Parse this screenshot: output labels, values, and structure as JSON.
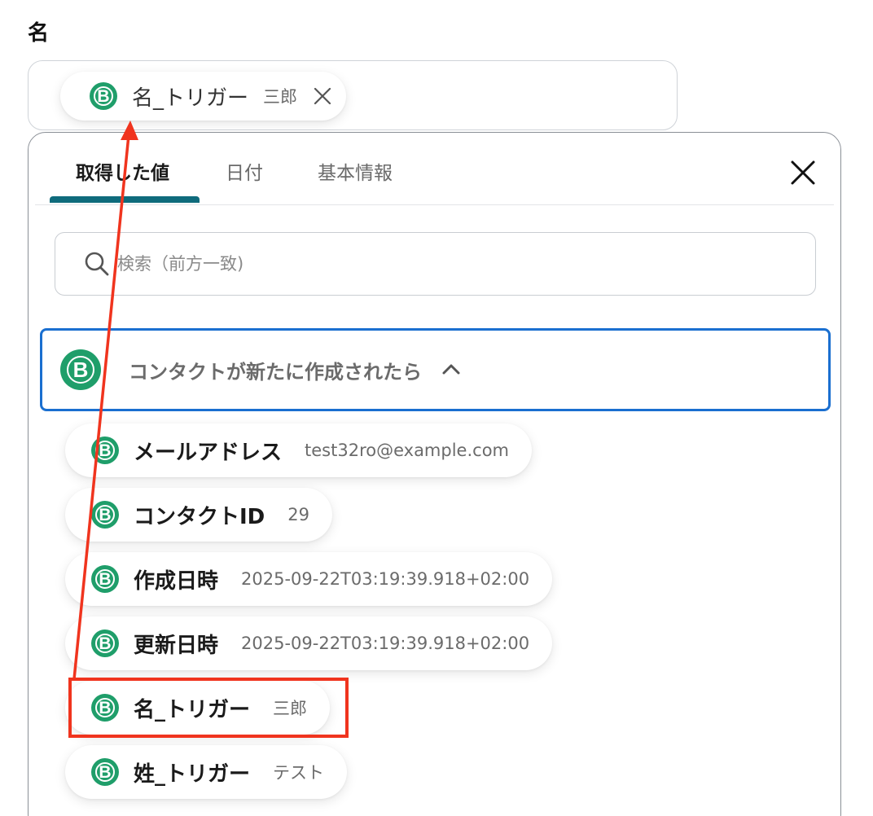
{
  "field": {
    "label": "名",
    "selected_chip": {
      "label": "名_トリガー",
      "value": "三郎"
    }
  },
  "tabs": [
    {
      "label": "取得した値",
      "active": true
    },
    {
      "label": "日付",
      "active": false
    },
    {
      "label": "基本情報",
      "active": false
    }
  ],
  "search": {
    "placeholder": "検索（前方一致)"
  },
  "section": {
    "title": "コンタクトが新たに作成されたら",
    "icon_letter": "B",
    "items": [
      {
        "label": "メールアドレス",
        "value": "test32ro@example.com"
      },
      {
        "label": "コンタクトID",
        "value": "29"
      },
      {
        "label": "作成日時",
        "value": "2025-09-22T03:19:39.918+02:00"
      },
      {
        "label": "更新日時",
        "value": "2025-09-22T03:19:39.918+02:00"
      },
      {
        "label": "名_トリガー",
        "value": "三郎",
        "highlighted": true
      },
      {
        "label": "姓_トリガー",
        "value": "テスト"
      }
    ]
  },
  "colors": {
    "brand_green": "#1f9e6a",
    "tab_underline": "#0f6b7c",
    "section_border": "#1a6fd0",
    "annotation_red": "#f0341e"
  },
  "icons": [
    "b-logo-icon",
    "close-icon",
    "search-icon",
    "chevron-up-icon",
    "arrow-annotation"
  ]
}
